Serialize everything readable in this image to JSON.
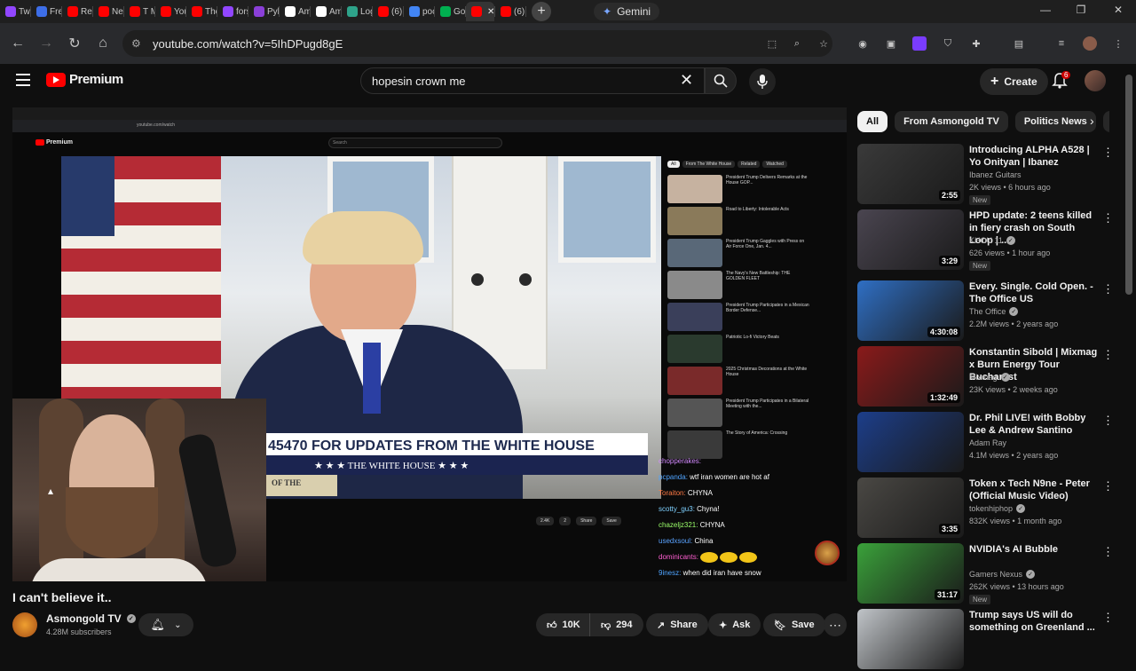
{
  "browser": {
    "tabs": [
      {
        "label": "Twi",
        "icon": "twitch-icon",
        "color": "#9146ff"
      },
      {
        "label": "Fre",
        "icon": "tracker-icon",
        "color": "#3d6ee8"
      },
      {
        "label": "Re",
        "icon": "youtube-icon",
        "color": "#ff0000"
      },
      {
        "label": "Nel",
        "icon": "youtube-icon",
        "color": "#ff0000"
      },
      {
        "label": "T M",
        "icon": "youtube-icon",
        "color": "#ff0000"
      },
      {
        "label": "You",
        "icon": "youtube-icon",
        "color": "#ff0000"
      },
      {
        "label": "The",
        "icon": "youtube-icon",
        "color": "#ff0000"
      },
      {
        "label": "fors",
        "icon": "twitch-icon",
        "color": "#9146ff"
      },
      {
        "label": "Pyk",
        "icon": "pyke-icon",
        "color": "#8a3fd8"
      },
      {
        "label": "Am",
        "icon": "amazon-icon",
        "color": "#ffffff"
      },
      {
        "label": "Am",
        "icon": "amazon-icon",
        "color": "#ffffff"
      },
      {
        "label": "Log",
        "icon": "logo-icon",
        "color": "#2ea38a"
      },
      {
        "label": "(6)",
        "icon": "youtube-icon",
        "color": "#ff0000"
      },
      {
        "label": "poc",
        "icon": "google-icon",
        "color": "#4285f4"
      },
      {
        "label": "Go",
        "icon": "green-icon",
        "color": "#00b050"
      },
      {
        "label": "",
        "icon": "youtube-icon",
        "color": "#ff0000",
        "active": true
      },
      {
        "label": "(6)",
        "icon": "youtube-icon",
        "color": "#ff0000"
      }
    ],
    "gemini_label": "Gemini",
    "url": "youtube.com/watch?v=5IhDPugd8gE"
  },
  "header": {
    "logo_text": "Premium",
    "search_value": "hopesin crown me",
    "create_label": "Create",
    "notification_count": "6"
  },
  "player": {
    "inner_search_placeholder": "Search",
    "inner_logo": "Premium",
    "lower_third_text": "45470 FOR UPDATES FROM THE WHITE HOUSE",
    "lower_band_text": "★ ★ ★  THE WHITE HOUSE  ★ ★ ★",
    "seal_text": "OF THE",
    "inner_actions": [
      "2.4K",
      "2",
      "Share",
      "Save"
    ],
    "inner_recs": [
      "President Trump Delivers Remarks at the House GOP...",
      "Road to Liberty: Intolerable Acts",
      "President Trump Gaggles with Press on Air Force One, Jan. 4...",
      "The Navy's New Battleship: THE GOLDEN FLEET",
      "President Trump Participates in a Mexican Border Defense...",
      "Patriotic Lo-fi Victory Beats",
      "2025 Christmas Decorations at the White House",
      "President Trump Participates in a Bilateral Meeting with the...",
      "The Story of America: Crossing"
    ],
    "inner_chips": [
      "All",
      "From The White House",
      "Related",
      "Watched"
    ],
    "chat": [
      {
        "user": "chopperakes:",
        "msg": ""
      },
      {
        "user": "pcpanda:",
        "msg": "wtf iran women are hot af"
      },
      {
        "user": "Toraiton:",
        "msg": "CHYNA"
      },
      {
        "user": "scotty_gu3:",
        "msg": "Chyna!"
      },
      {
        "user": "chazeljz321:",
        "msg": "CHYNA"
      },
      {
        "user": "usedxsoul:",
        "msg": "China"
      },
      {
        "user": "dominicants:",
        "msg": ""
      },
      {
        "user": "9inesz:",
        "msg": "when did iran have snow"
      }
    ]
  },
  "video": {
    "title": "I can't believe it..",
    "channel": "Asmongold TV",
    "subscribers": "4.28M subscribers",
    "likes": "10K",
    "dislikes": "294",
    "share_label": "Share",
    "ask_label": "Ask",
    "save_label": "Save"
  },
  "sidebar": {
    "chips": [
      "All",
      "From Asmongold TV",
      "Politics News",
      "R"
    ],
    "recommendations": [
      {
        "title": "Introducing ALPHA A528 | Yo Onityan | Ibanez",
        "channel": "Ibanez Guitars",
        "verified": false,
        "meta": "2K views • 6 hours ago",
        "duration": "2:55",
        "new": "New",
        "thumb": "#3a3a3a"
      },
      {
        "title": "HPD update: 2 teens killed in fiery crash on South Loop | ...",
        "channel": "KHOU 11",
        "verified": true,
        "meta": "626 views • 1 hour ago",
        "duration": "3:29",
        "new": "New",
        "thumb": "#4a4550"
      },
      {
        "title": "Every. Single. Cold Open. - The Office US",
        "channel": "The Office",
        "verified": true,
        "meta": "2.2M views • 2 years ago",
        "duration": "4:30:08",
        "new": "",
        "thumb": "#2f6fc4"
      },
      {
        "title": "Konstantin Sibold | Mixmag x Burn Energy Tour Bucharest",
        "channel": "Mixmag",
        "verified": true,
        "meta": "23K views • 2 weeks ago",
        "duration": "1:32:49",
        "new": "",
        "thumb": "#8a1a1a"
      },
      {
        "title": "Dr. Phil LIVE! with Bobby Lee & Andrew Santino",
        "channel": "Adam Ray",
        "verified": false,
        "meta": "4.1M views • 2 years ago",
        "duration": "",
        "new": "",
        "thumb": "#1c3e8a"
      },
      {
        "title": "Token x Tech N9ne - Peter (Official Music Video)",
        "channel": "tokenhiphop",
        "verified": true,
        "meta": "832K views • 1 month ago",
        "duration": "3:35",
        "new": "",
        "thumb": "#4a4844"
      },
      {
        "title": "NVIDIA's AI Bubble",
        "channel": "Gamers Nexus",
        "verified": true,
        "meta": "262K views • 13 hours ago",
        "duration": "31:17",
        "new": "New",
        "thumb": "#3aa13a"
      },
      {
        "title": "Trump says US will do something on Greenland ...",
        "channel": "",
        "verified": false,
        "meta": "",
        "duration": "",
        "new": "",
        "thumb": "#c0c4c8"
      }
    ]
  }
}
